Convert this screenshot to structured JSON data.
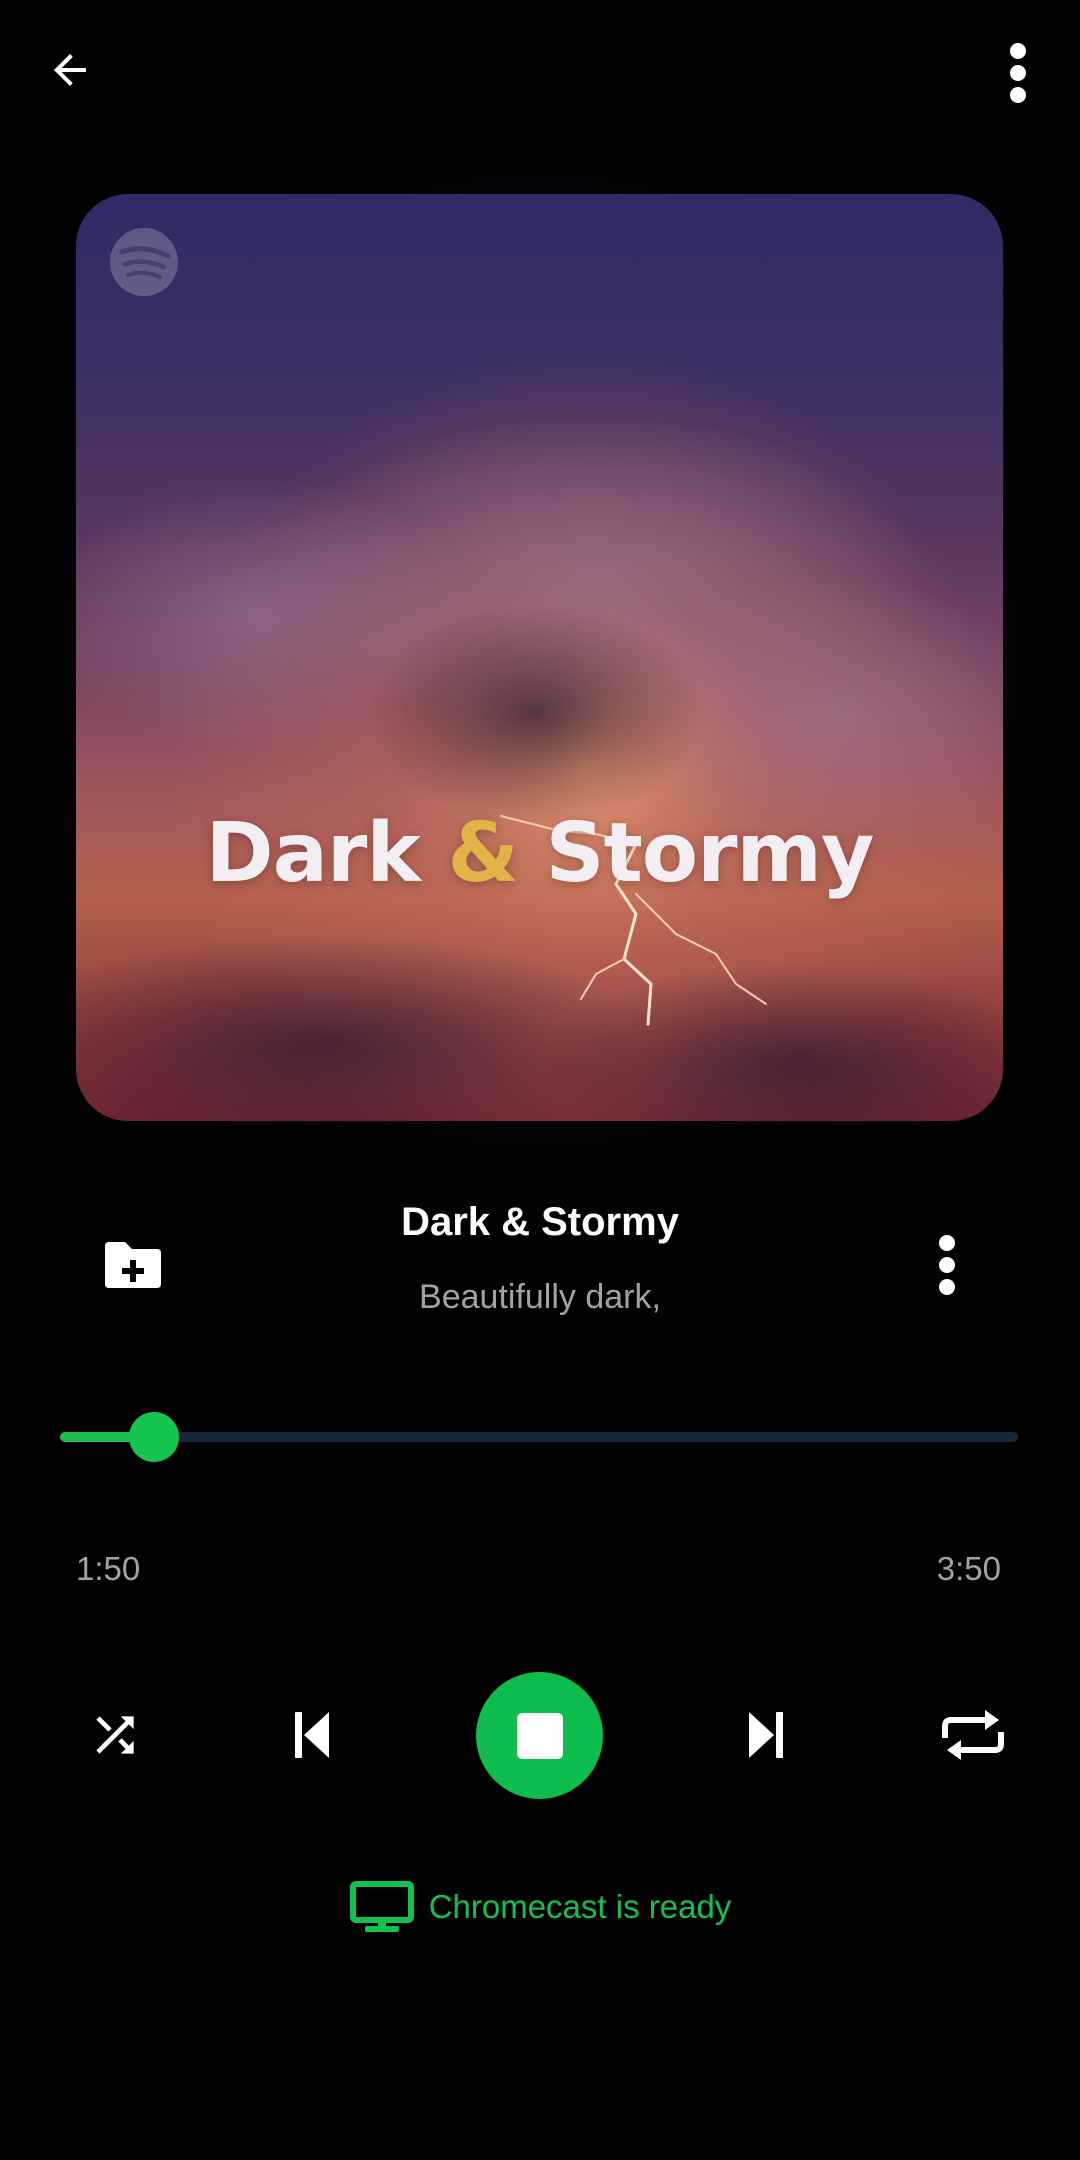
{
  "header": {
    "back_icon": "arrow-left-icon",
    "menu_icon": "more-vertical-icon"
  },
  "album_art": {
    "brand_icon": "spotify-icon",
    "title_part1": "Dark",
    "title_amp": "&",
    "title_part2": "Stormy"
  },
  "track": {
    "title": "Dark & Stormy",
    "subtitle": "Beautifully dark,",
    "add_icon": "folder-plus-icon",
    "more_icon": "more-vertical-icon"
  },
  "progress": {
    "elapsed": "1:50",
    "duration": "3:50",
    "fraction": 0.098
  },
  "controls": {
    "shuffle_icon": "shuffle-icon",
    "previous_icon": "skip-previous-icon",
    "stop_icon": "stop-icon",
    "next_icon": "skip-next-icon",
    "repeat_icon": "repeat-icon"
  },
  "cast": {
    "icon": "tv-icon",
    "label": "Chromecast is ready"
  },
  "colors": {
    "accent": "#0fbd4d",
    "background": "#000000",
    "track_bg": "#17273a",
    "secondary_text": "#a3a3a3"
  }
}
